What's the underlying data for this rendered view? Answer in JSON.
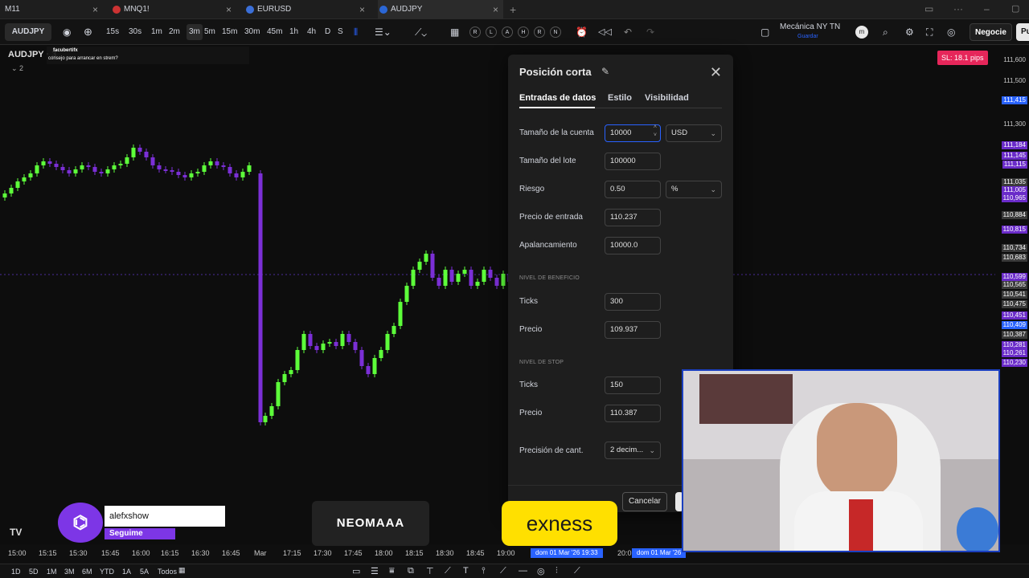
{
  "tabs": [
    {
      "label": "M11"
    },
    {
      "label": "MNQ1!"
    },
    {
      "label": "EURUSD"
    },
    {
      "label": "AUDJPY"
    }
  ],
  "toolbar": {
    "symbol": "AUDJPY",
    "intervals": [
      "15s",
      "30s",
      "1m",
      "2m",
      "3m",
      "5m",
      "15m",
      "30m",
      "45m",
      "1h",
      "4h",
      "D",
      "S"
    ],
    "active_interval": "3m",
    "replay_letters": [
      "R",
      "L",
      "A",
      "H",
      "R",
      "N"
    ],
    "session_name": "Mecánica NY TN",
    "session_sub": "Guardar",
    "trade_button": "Negocie",
    "publish_button": "Pu"
  },
  "legend": {
    "symbol_line": "AUDJPY · 3",
    "indicator_count": "2",
    "chat_user": "facubertifx",
    "chat_msg": "consejo para arrancar en strem?"
  },
  "price_axis": [
    {
      "label": "111,600",
      "style": ""
    },
    {
      "label": "111,500",
      "style": ""
    },
    {
      "label": "111,415",
      "style": "hb"
    },
    {
      "label": "111,300",
      "style": ""
    },
    {
      "label": "111,184",
      "style": "hl"
    },
    {
      "label": "111,145",
      "style": "hl"
    },
    {
      "label": "111,115",
      "style": "hl"
    },
    {
      "label": "111,035",
      "style": "gr"
    },
    {
      "label": "111,005",
      "style": "hl"
    },
    {
      "label": "110,965",
      "style": "hl"
    },
    {
      "label": "110,884",
      "style": "gr"
    },
    {
      "label": "110,815",
      "style": "hl"
    },
    {
      "label": "110,734",
      "style": "gr"
    },
    {
      "label": "110,683",
      "style": "gr"
    },
    {
      "label": "110,599",
      "style": "hl"
    },
    {
      "label": "110,565",
      "style": "gr"
    },
    {
      "label": "110,541",
      "style": "gr"
    },
    {
      "label": "110,475",
      "style": "gr"
    },
    {
      "label": "110,451",
      "style": "hl"
    },
    {
      "label": "110,409",
      "style": "hb"
    },
    {
      "label": "110,387",
      "style": "gr"
    },
    {
      "label": "110,281",
      "style": "hl"
    },
    {
      "label": "110,261",
      "style": "hl"
    },
    {
      "label": "110,230",
      "style": "hl"
    }
  ],
  "stop_badge": "SL: 18.1 pips",
  "time_axis": [
    "15:00",
    "15:15",
    "15:30",
    "15:45",
    "16:00",
    "16:15",
    "16:30",
    "16:45",
    "Mar",
    "17:15",
    "17:30",
    "17:45",
    "18:00",
    "18:15",
    "18:30",
    "18:45",
    "19:00",
    "20:0"
  ],
  "time_tags": [
    "dom 01 Mar '26   19:33",
    "dom 01 Mar '26"
  ],
  "bottom": {
    "ranges": [
      "1D",
      "5D",
      "1M",
      "3M",
      "6M",
      "YTD",
      "1A",
      "5A",
      "Todos"
    ]
  },
  "panel": {
    "title": "Posición corta",
    "tabs": [
      "Entradas de datos",
      "Estilo",
      "Visibilidad"
    ],
    "fields": {
      "account_size_label": "Tamaño de la cuenta",
      "account_size_value": "10000",
      "currency": "USD",
      "lot_size_label": "Tamaño del lote",
      "lot_size_value": "100000",
      "risk_label": "Riesgo",
      "risk_value": "0.50",
      "risk_unit": "%",
      "entry_label": "Precio de entrada",
      "entry_value": "110.237",
      "leverage_label": "Apalancamiento",
      "leverage_value": "10000.0",
      "profit_section": "NIVEL DE BENEFICIO",
      "profit_ticks_label": "Ticks",
      "profit_ticks_value": "300",
      "profit_price_label": "Precio",
      "profit_price_value": "109.937",
      "stop_section": "NIVEL DE STOP",
      "stop_ticks_label": "Ticks",
      "stop_ticks_value": "150",
      "stop_price_label": "Precio",
      "stop_price_value": "110.387",
      "qty_precision_label": "Precisión de cant.",
      "qty_precision_value": "2 decim..."
    },
    "cancel": "Cancelar"
  },
  "overlays": {
    "twitch_user": "alefxshow",
    "twitch_follow": "Seguime",
    "sponsor1": "NEOMAAA",
    "sponsor2": "exness"
  },
  "colors": {
    "bull": "#5dff3a",
    "bear": "#7b2fd6",
    "accent": "#2962ff",
    "stop": "#e6265a"
  }
}
